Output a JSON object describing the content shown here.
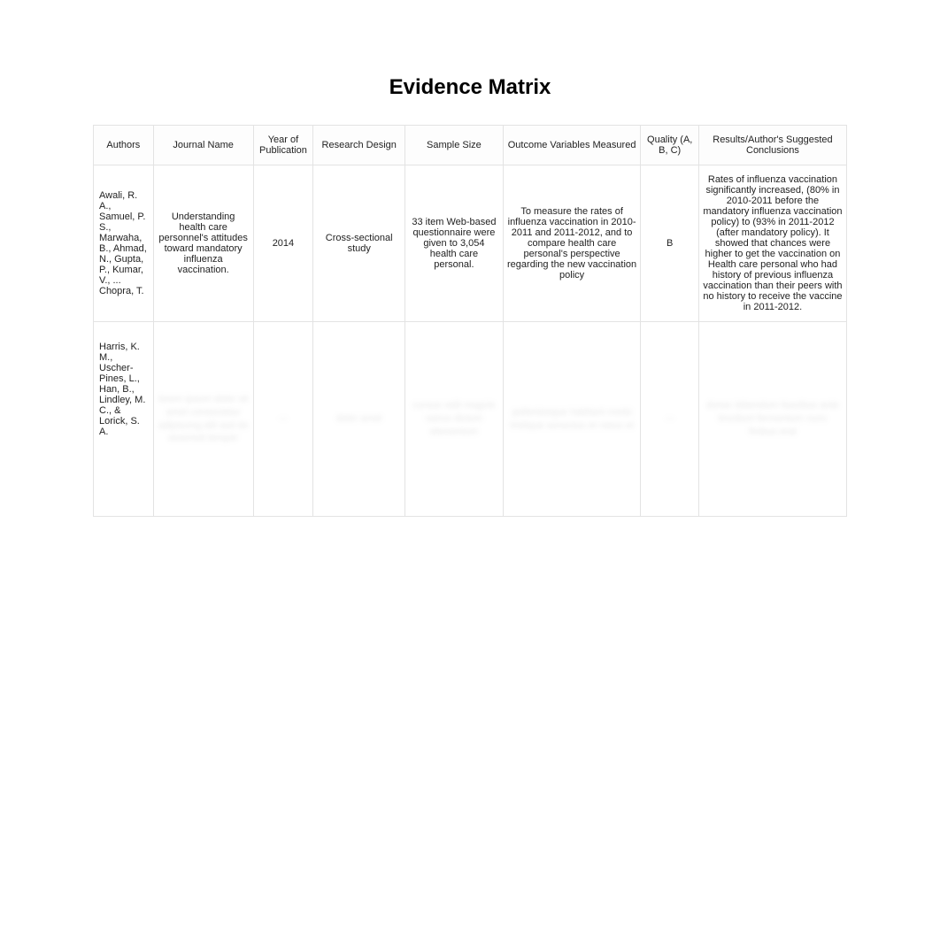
{
  "title": "Evidence Matrix",
  "headers": {
    "authors": "Authors",
    "journal": "Journal Name",
    "year": "Year of Publication",
    "design": "Research Design",
    "sample": "Sample Size",
    "outcomes": "Outcome Variables Measured",
    "quality": "Quality (A, B, C)",
    "results": "Results/Author's Suggested Conclusions"
  },
  "rows": [
    {
      "authors": "Awali, R. A., Samuel, P. S., Marwaha, B., Ahmad, N., Gupta, P., Kumar, V., ... Chopra, T.",
      "journal": "Understanding health care personnel's attitudes toward mandatory influenza vaccination.",
      "year": "2014",
      "design": "Cross-sectional study",
      "sample": "33 item Web-based questionnaire were given to 3,054 health care personal.",
      "outcomes": "To measure the rates of influenza vaccination in 2010-2011 and 2011-2012, and to compare health care personal's perspective regarding the new vaccination policy",
      "quality": "B",
      "results": "Rates of influenza vaccination significantly increased, (80% in 2010-2011 before the mandatory influenza vaccination policy) to (93% in 2011-2012 (after mandatory policy). It showed that chances were higher to get the vaccination on Health care personal who had history of previous influenza vaccination than their peers with no history to receive the vaccine in 2011-2012."
    },
    {
      "authors": "Harris, K. M., Uscher-Pines, L., Han, B., Lindley, M. C., & Lorick, S. A.",
      "journal_blur": "lorem ipsum dolor sit amet consectetur adipiscing elit sed do eiusmod tempor",
      "year_blur": "—",
      "design_blur": "dolor amet",
      "sample_blur": "cursus velit magnis varius dictum elementum",
      "outcomes_blur": "pellentesque habitant morbi tristique senectus et netus et",
      "quality_blur": "—",
      "results_blur": "donec bibendum faucibus ante tincidunt fermentum nunc finibus erat"
    }
  ]
}
